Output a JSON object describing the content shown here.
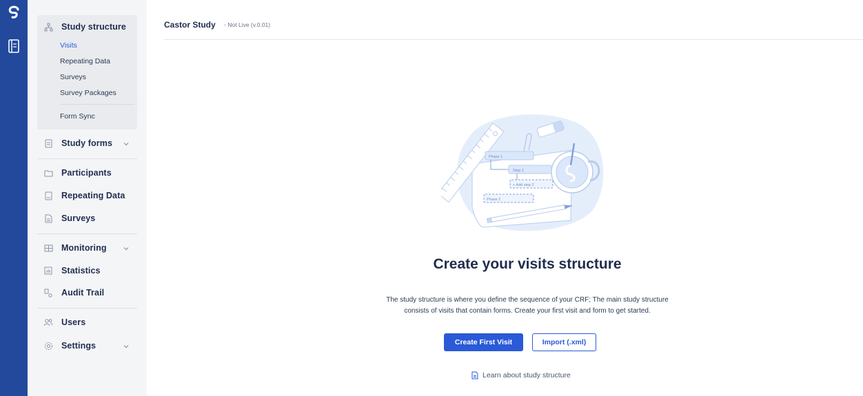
{
  "header": {
    "study_name": "Castor Study",
    "status": "Not Live (v.0.01)"
  },
  "sidebar": {
    "study_structure": {
      "label": "Study structure",
      "items": [
        "Visits",
        "Repeating Data",
        "Surveys",
        "Survey Packages"
      ],
      "form_sync": "Form Sync",
      "active": "Visits"
    },
    "study_forms": "Study forms",
    "participants": "Participants",
    "repeating_data": "Repeating Data",
    "surveys": "Surveys",
    "monitoring": "Monitoring",
    "statistics": "Statistics",
    "audit_trail": "Audit Trail",
    "users": "Users",
    "settings": "Settings"
  },
  "illustration": {
    "phase1": "Phase 1",
    "step1": "Step 1",
    "add_step2": "+ Add step 2",
    "phase2": "Phase 2"
  },
  "main": {
    "heading": "Create your visits structure",
    "description_line1": "The study structure is where you define the sequence of your CRF; The main study structure",
    "description_line2": "consists of visits that contain forms. Create your first visit and form to get started.",
    "create_button": "Create First Visit",
    "import_button": "Import (.xml)",
    "learn_link": "Learn about study structure"
  },
  "colors": {
    "rail": "#22499c",
    "accent": "#2a5ad7",
    "text": "#1f2d4d",
    "sidebar_bg": "#f4f5f7"
  },
  "icons": [
    "castor-logo-icon",
    "book-icon",
    "hierarchy-icon",
    "form-icon",
    "folder-icon",
    "document-icon",
    "monitor-icon",
    "bar-chart-icon",
    "audit-icon",
    "users-icon",
    "gear-icon",
    "chevron-down-icon",
    "doc-link-icon"
  ]
}
